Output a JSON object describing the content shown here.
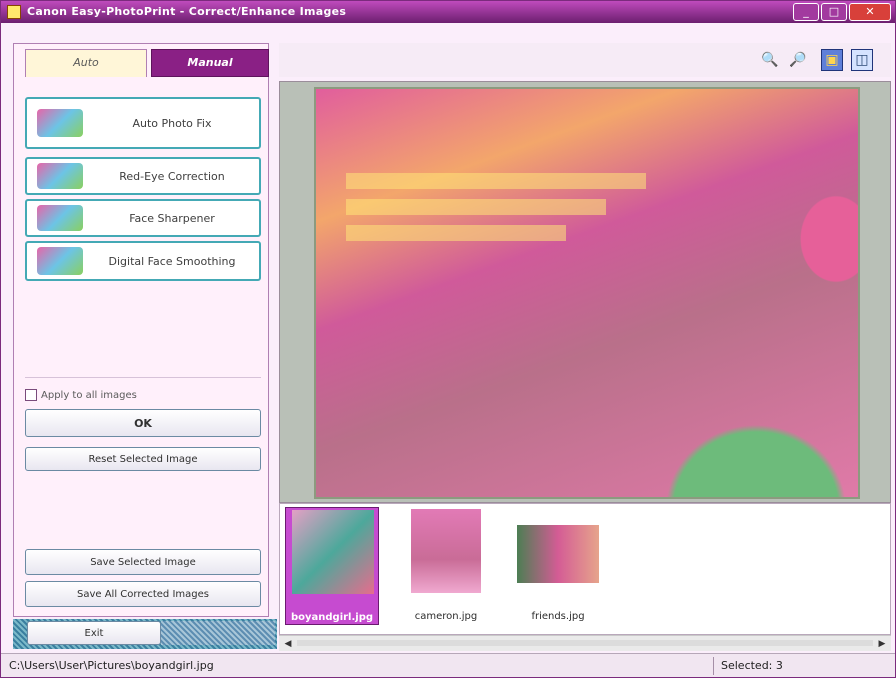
{
  "window": {
    "title": "Canon Easy-PhotoPrint - Correct/Enhance Images",
    "minimize": "_",
    "maximize": "□",
    "close": "✕"
  },
  "tabs": [
    {
      "label": "Auto",
      "active": true
    },
    {
      "label": "Manual",
      "active": false
    }
  ],
  "left": {
    "buttons": [
      {
        "label": "Auto Photo Fix"
      },
      {
        "label": "Red-Eye Correction"
      },
      {
        "label": "Face Sharpener"
      },
      {
        "label": "Digital Face Smoothing"
      }
    ],
    "apply_all_label": "Apply to all images",
    "ok_label": "OK",
    "reset_label": "Reset Selected Image",
    "save_selected_label": "Save Selected Image",
    "save_all_label": "Save All Corrected Images",
    "exit_label": "Exit"
  },
  "toolbar": {
    "icons": [
      "zoom-in-icon",
      "zoom-out-icon",
      "view-whole-image-icon",
      "view-compare-icon"
    ]
  },
  "thumbnails": [
    {
      "caption": "boyandgirl.jpg",
      "selected": true
    },
    {
      "caption": "cameron.jpg",
      "selected": false
    },
    {
      "caption": "friends.jpg",
      "selected": false
    }
  ],
  "status": {
    "path": "C:\\Users\\User\\Pictures\\boyandgirl.jpg",
    "selected": "Selected: 3"
  },
  "colors": {
    "title_bar": "#6c1f6f",
    "manual_tab": "#8a2085",
    "accent_teal": "#44a9b5"
  }
}
